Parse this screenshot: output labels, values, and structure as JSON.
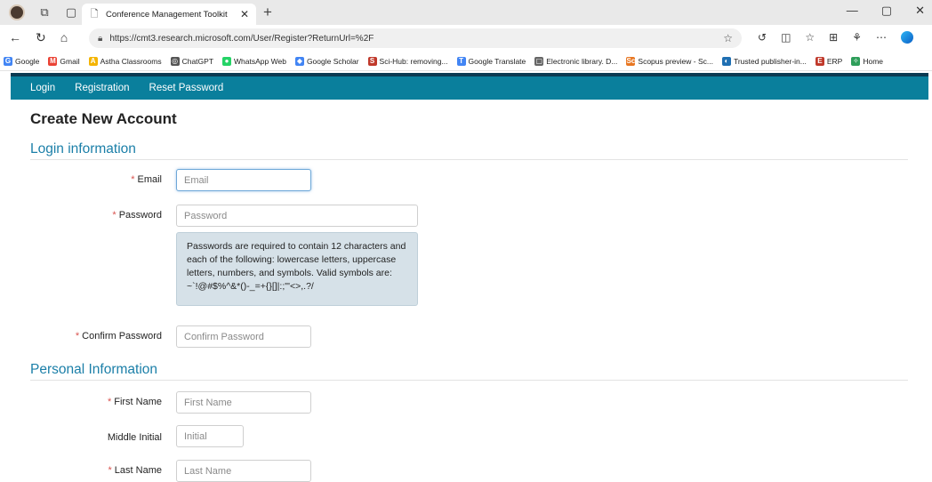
{
  "browser": {
    "tab_title": "Conference Management Toolkit",
    "url": "https://cmt3.research.microsoft.com/User/Register?ReturnUrl=%2F",
    "bookmarks": [
      {
        "label": "Google",
        "color": "#4285f4",
        "glyph": "G"
      },
      {
        "label": "Gmail",
        "color": "#ea4335",
        "glyph": "M"
      },
      {
        "label": "Astha Classrooms",
        "color": "#f4b400",
        "glyph": "A"
      },
      {
        "label": "ChatGPT",
        "color": "#555555",
        "glyph": "◎"
      },
      {
        "label": "WhatsApp Web",
        "color": "#25d366",
        "glyph": "●"
      },
      {
        "label": "Google Scholar",
        "color": "#4285f4",
        "glyph": "◆"
      },
      {
        "label": "Sci-Hub: removing...",
        "color": "#c0392b",
        "glyph": "S"
      },
      {
        "label": "Google Translate",
        "color": "#4285f4",
        "glyph": "T"
      },
      {
        "label": "Electronic library. D...",
        "color": "#666666",
        "glyph": "▢"
      },
      {
        "label": "Scopus preview - Sc...",
        "color": "#e87722",
        "glyph": "Sc"
      },
      {
        "label": "Trusted publisher-in...",
        "color": "#1f6fb2",
        "glyph": "◐"
      },
      {
        "label": "ERP",
        "color": "#c0392b",
        "glyph": "E"
      },
      {
        "label": "Home",
        "color": "#2e9e5a",
        "glyph": "✧"
      }
    ]
  },
  "nav": {
    "login": "Login",
    "registration": "Registration",
    "reset_password": "Reset Password"
  },
  "page": {
    "title": "Create New Account",
    "login_section": "Login information",
    "personal_section": "Personal Information"
  },
  "fields": {
    "email": {
      "label": "Email",
      "placeholder": "Email",
      "value": ""
    },
    "password": {
      "label": "Password",
      "placeholder": "Password",
      "value": ""
    },
    "password_note": "Passwords are required to contain 12 characters and each of the following: lowercase letters, uppercase letters, numbers, and symbols. Valid symbols are: ~`!@#$%^&*()-_=+{}[]|:;\"'<>,.?/",
    "confirm_password": {
      "label": "Confirm Password",
      "placeholder": "Confirm Password",
      "value": ""
    },
    "first_name": {
      "label": "First Name",
      "placeholder": "First Name",
      "value": ""
    },
    "middle_initial": {
      "label": "Middle Initial",
      "placeholder": "Initial",
      "value": ""
    },
    "last_name": {
      "label": "Last Name",
      "placeholder": "Last Name",
      "value": ""
    }
  },
  "required_marker": "*",
  "colors": {
    "nav_bar": "#0a7f9c",
    "section_heading": "#1b7fa8",
    "required": "#d9534f",
    "note_background": "#d6e1e8"
  }
}
